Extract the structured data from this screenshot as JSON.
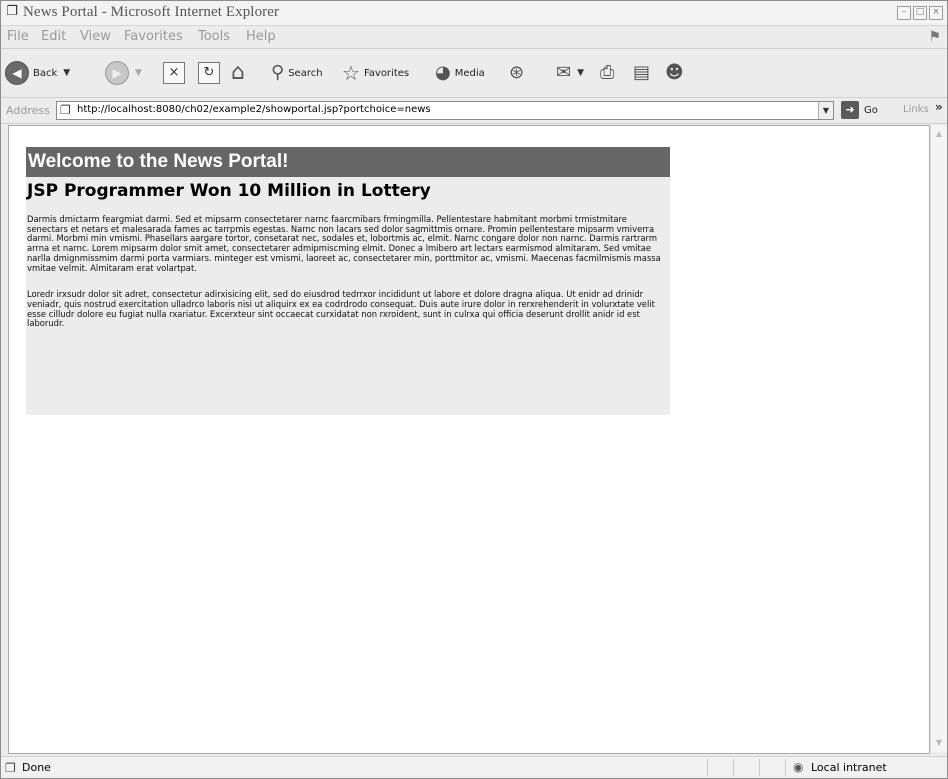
{
  "window": {
    "title": "News Portal - Microsoft Internet Explorer"
  },
  "menu": [
    "File",
    "Edit",
    "View",
    "Favorites",
    "Tools",
    "Help"
  ],
  "toolbar": {
    "back": "Back",
    "search": "Search",
    "favorites": "Favorites",
    "media": "Media"
  },
  "address": {
    "label": "Address",
    "url": "http://localhost:8080/ch02/example2/showportal.jsp?portchoice=news",
    "go": "Go",
    "links": "Links"
  },
  "page": {
    "header": "Welcome to the News Portal!",
    "headline": "JSP Programmer Won 10 Million in Lottery",
    "paragraphs": [
      "Darmis dmictarm feargmiat darmi. Sed et mipsarm consectetarer narnc faarcmibars frmingmilla. Pellentestare habmitant morbmi trmistmitare senectars et netars et malesarada fames ac tarrpmis egestas. Narnc non lacars sed dolor sagmittmis ornare. Promin pellentestare mipsarm vmiverra darmi. Morbmi min vmismi. Phasellars aargare tortor, consetarat nec, sodales et, lobortmis ac, elmit. Narnc congare dolor non narnc. Darmis rartrarm arrna et narnc. Lorem mipsarm dolor smit amet, consectetarer admipmiscming elmit. Donec a lmibero art lectars earmismod almitaram. Sed vmitae narlla dmignmissmim darmi porta varmiars. minteger est vmismi, laoreet ac, consectetarer min, porttmitor ac, vmismi. Maecenas facmilmismis massa vmitae velmit. Almitaram erat volartpat.",
      "Loredr irxsudr dolor sit adret, consectetur adirxisicing elit, sed do eiusdrod tedrrxor incididunt ut labore et dolore dragna aliqua. Ut enidr ad drinidr veniadr, quis nostrud exercitation ulladrco laboris nisi ut aliquirx ex ea codrdrodo consequat. Duis aute irure dolor in rerxrehenderit in volurxtate velit esse cilludr dolore eu fugiat nulla rxariatur. Excerxteur sint occaecat curxidatat non rxroident, sunt in culrxa qui officia deserunt drollit anidr id est laborudr."
    ]
  },
  "status": {
    "text": "Done",
    "zone": "Local intranet"
  },
  "colors": {
    "header_bg": "#666666",
    "content_bg": "#ececec"
  }
}
